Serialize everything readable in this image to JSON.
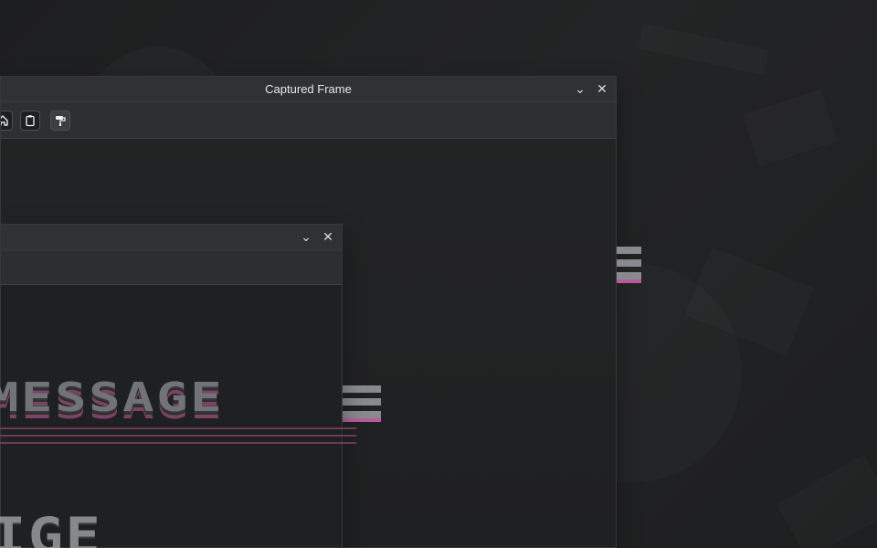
{
  "desktop": {
    "background_name": "dark-textured-wallpaper",
    "accent_pink": "#c05f9f",
    "text_color": "#e6e7e8"
  },
  "main_window": {
    "title": "Captured Frame",
    "controls": {
      "minimize_icon": "chevron-down-icon",
      "close_icon": "close-icon",
      "minimize_glyph": "⌄",
      "close_glyph": "✕"
    },
    "toolbar": {
      "buttons": [
        {
          "icon": "home-icon"
        },
        {
          "icon": "clipboard-icon"
        },
        {
          "icon": "paint-roller-icon"
        }
      ]
    }
  },
  "inner_window": {
    "title": "",
    "controls": {
      "minimize_icon": "chevron-down-icon",
      "close_icon": "close-icon",
      "minimize_glyph": "⌄",
      "close_glyph": "✕"
    }
  },
  "canvas_text": {
    "banner": "MESSAGE",
    "lower_fragment": "IGE"
  }
}
